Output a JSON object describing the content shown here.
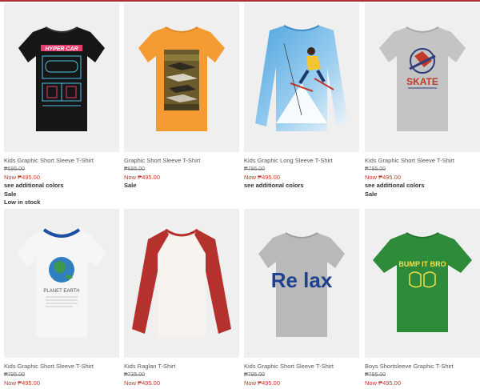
{
  "products": [
    {
      "title": "Kids Graphic Short Sleeve T-Shirt",
      "old_price": "₱695.00",
      "now_price": "Now ₱495.00",
      "extras": [
        "see additional colors",
        "Sale",
        "Low in stock"
      ],
      "graphic_text": "HYPER CAR",
      "shirt_color": "#161616"
    },
    {
      "title": "Graphic Short Sleeve T-Shirt",
      "old_price": "₱695.00",
      "now_price": "Now ₱495.00",
      "extras": [
        "Sale"
      ],
      "graphic_text": "",
      "shirt_color": "#f59b33"
    },
    {
      "title": "Kids Graphic Long Sleeve T-Shirt",
      "old_price": "₱795.00",
      "now_price": "Now ₱495.00",
      "extras": [
        "see additional colors"
      ],
      "graphic_text": "",
      "shirt_color": "#f4f6f8"
    },
    {
      "title": "Kids Graphic Short Sleeve T-Shirt",
      "old_price": "₱795.00",
      "now_price": "Now ₱495.00",
      "extras": [
        "see additional colors",
        "Sale"
      ],
      "graphic_text": "SKATE",
      "shirt_color": "#c4c4c4"
    },
    {
      "title": "Kids Graphic Short Sleeve T-Shirt",
      "old_price": "₱795.00",
      "now_price": "Now ₱495.00",
      "extras": [],
      "graphic_text": "PLANET EARTH",
      "shirt_color": "#f6f6f6"
    },
    {
      "title": "Kids Raglan T-Shirt",
      "old_price": "₱735.00",
      "now_price": "Now ₱495.00",
      "extras": [],
      "graphic_text": "",
      "shirt_color": "#f7f4ef"
    },
    {
      "title": "Kids Graphic Short Sleeve T-Shirt",
      "old_price": "₱795.00",
      "now_price": "Now ₱495.00",
      "extras": [],
      "graphic_text": "Re lax",
      "shirt_color": "#b9b9b9"
    },
    {
      "title": "Boys Shortsleeve Graphic T-Shirt",
      "old_price": "₱795.00",
      "now_price": "Now ₱495.00",
      "extras": [],
      "graphic_text": "BUMP IT BRO",
      "shirt_color": "#2e8b3a"
    }
  ]
}
